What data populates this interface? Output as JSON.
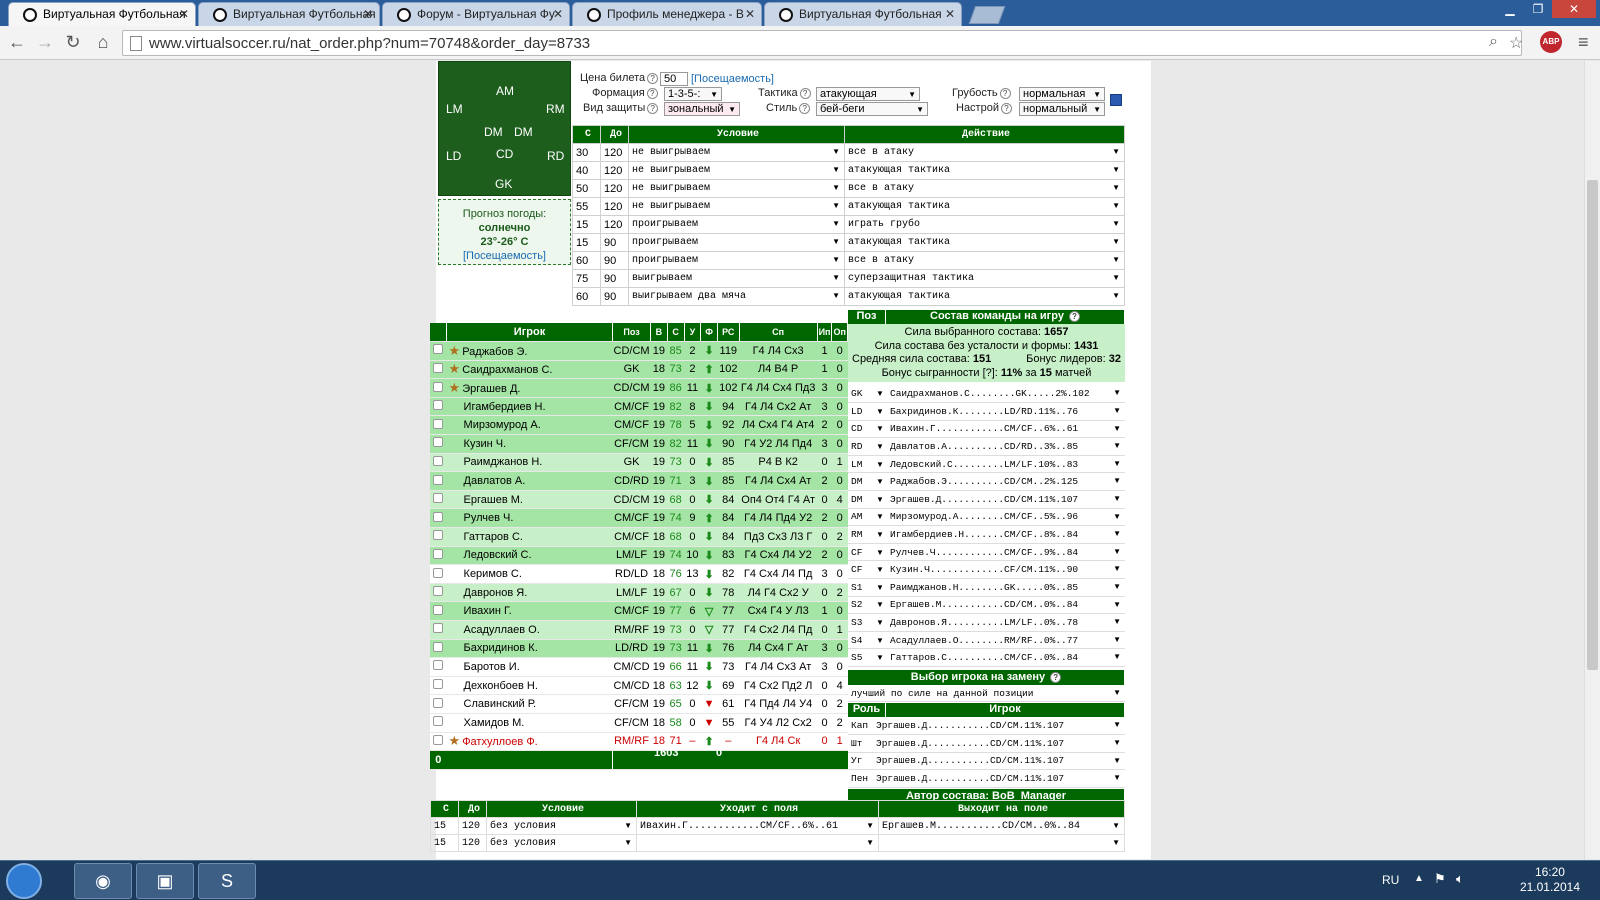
{
  "browser": {
    "tabs": [
      {
        "title": "Виртуальная Футбольная",
        "active": true
      },
      {
        "title": "Виртуальная Футбольная",
        "active": false
      },
      {
        "title": "Форум - Виртуальная Фу",
        "active": false
      },
      {
        "title": "Профиль менеджера - В",
        "active": false
      },
      {
        "title": "Виртуальная Футбольная",
        "active": false
      }
    ],
    "url": "www.virtualsoccer.ru/nat_order.php?num=70748&order_day=8733",
    "abp": "ABP"
  },
  "field": {
    "positions": [
      "AM",
      "LM",
      "RM",
      "DM",
      "DM",
      "LD",
      "CD",
      "RD",
      "GK"
    ]
  },
  "weather": {
    "label": "Прогноз погоды:",
    "condition": "солнечно",
    "temp": "23°-26° C",
    "link": "[Посещаемость]"
  },
  "settings": {
    "ticket_label": "Цена билета",
    "ticket_value": "50",
    "attendance_link": "[Посещаемость]",
    "formation_label": "Формация",
    "formation_value": "1-3-5-:",
    "defense_label": "Вид защиты",
    "defense_value": "зональный",
    "tactics_label": "Тактика",
    "tactics_value": "атакующая",
    "style_label": "Стиль",
    "style_value": "бей-беги",
    "rough_label": "Грубость",
    "rough_value": "нормальная",
    "mood_label": "Настрой",
    "mood_value": "нормальный"
  },
  "conditions": {
    "headers": [
      "С",
      "До",
      "Условие",
      "Действие"
    ],
    "rows": [
      [
        "30",
        "120",
        "не выигрываем",
        "все в атаку"
      ],
      [
        "40",
        "120",
        "не выигрываем",
        "атакующая тактика"
      ],
      [
        "50",
        "120",
        "не выигрываем",
        "все в атаку"
      ],
      [
        "55",
        "120",
        "не выигрываем",
        "атакующая тактика"
      ],
      [
        "15",
        "120",
        "проигрываем",
        "играть грубо"
      ],
      [
        "15",
        "90",
        "проигрываем",
        "атакующая тактика"
      ],
      [
        "60",
        "90",
        "проигрываем",
        "все в атаку"
      ],
      [
        "75",
        "90",
        "выигрываем",
        "суперзащитная тактика"
      ],
      [
        "60",
        "90",
        "выигрываем два мяча",
        "атакующая тактика"
      ]
    ]
  },
  "players": {
    "headers": [
      "",
      "Игрок",
      "Поз",
      "В",
      "С",
      "У",
      "Ф",
      "РС",
      "Сп",
      "Ип",
      "Оп"
    ],
    "rows": [
      {
        "star": true,
        "name": "Раджабов Э.",
        "pos": "CD/CM",
        "age": "19",
        "s": "85",
        "u": "2",
        "f": "down",
        "rs": "119",
        "sp": "Г4 Л4 Сх3",
        "ip": "1",
        "op": "0",
        "shade": "pr"
      },
      {
        "star": true,
        "name": "Саидрахманов С.",
        "pos": "GK",
        "age": "18",
        "s": "73",
        "u": "2",
        "f": "up",
        "rs": "102",
        "sp": "Л4 В4 Р",
        "ip": "1",
        "op": "0",
        "shade": "pr"
      },
      {
        "star": true,
        "name": "Эргашев Д.",
        "pos": "CD/CM",
        "age": "19",
        "s": "86",
        "u": "11",
        "f": "down",
        "rs": "102",
        "sp": "Г4 Л4 Сх4 Пд3",
        "ip": "3",
        "op": "0",
        "shade": "pr"
      },
      {
        "star": false,
        "name": "Игамбердиев Н.",
        "pos": "CM/CF",
        "age": "19",
        "s": "82",
        "u": "8",
        "f": "down",
        "rs": "94",
        "sp": "Г4 Л4 Сх2 Ат",
        "ip": "3",
        "op": "0",
        "shade": "pr"
      },
      {
        "star": false,
        "name": "Мирзомурод А.",
        "pos": "CM/CF",
        "age": "19",
        "s": "78",
        "u": "5",
        "f": "down",
        "rs": "92",
        "sp": "Л4 Сх4 Г4 Ат4",
        "ip": "2",
        "op": "0",
        "shade": "pr"
      },
      {
        "star": false,
        "name": "Кузин Ч.",
        "pos": "CF/CM",
        "age": "19",
        "s": "82",
        "u": "11",
        "f": "down",
        "rs": "90",
        "sp": "Г4 У2 Л4 Пд4",
        "ip": "3",
        "op": "0",
        "shade": "pr"
      },
      {
        "star": false,
        "name": "Раимджанов Н.",
        "pos": "GK",
        "age": "19",
        "s": "73",
        "u": "0",
        "f": "down",
        "rs": "85",
        "sp": "Р4 В К2",
        "ip": "0",
        "op": "1",
        "shade": "pr alt"
      },
      {
        "star": false,
        "name": "Давлатов А.",
        "pos": "CD/RD",
        "age": "19",
        "s": "71",
        "u": "3",
        "f": "down",
        "rs": "85",
        "sp": "Г4 Л4 Сх4 Ат",
        "ip": "2",
        "op": "0",
        "shade": "pr"
      },
      {
        "star": false,
        "name": "Ергашев М.",
        "pos": "CD/CM",
        "age": "19",
        "s": "68",
        "u": "0",
        "f": "down",
        "rs": "84",
        "sp": "Оп4 От4 Г4 Ат",
        "ip": "0",
        "op": "4",
        "shade": "pr alt"
      },
      {
        "star": false,
        "name": "Рулчев Ч.",
        "pos": "CM/CF",
        "age": "19",
        "s": "74",
        "u": "9",
        "f": "up",
        "rs": "84",
        "sp": "Г4 Л4 Пд4 У2",
        "ip": "2",
        "op": "0",
        "shade": "pr"
      },
      {
        "star": false,
        "name": "Гаттаров С.",
        "pos": "CM/CF",
        "age": "18",
        "s": "68",
        "u": "0",
        "f": "down",
        "rs": "84",
        "sp": "Пд3 Сх3 Л3 Г",
        "ip": "0",
        "op": "2",
        "shade": "pr alt"
      },
      {
        "star": false,
        "name": "Ледовский С.",
        "pos": "LM/LF",
        "age": "19",
        "s": "74",
        "u": "10",
        "f": "down",
        "rs": "83",
        "sp": "Г4 Сх4 Л4 У2",
        "ip": "2",
        "op": "0",
        "shade": "pr"
      },
      {
        "star": false,
        "name": "Керимов С.",
        "pos": "RD/LD",
        "age": "18",
        "s": "76",
        "u": "13",
        "f": "down",
        "rs": "82",
        "sp": "Г4 Сх4 Л4 Пд",
        "ip": "3",
        "op": "0",
        "shade": "pr hi"
      },
      {
        "star": false,
        "name": "Давронов Я.",
        "pos": "LM/LF",
        "age": "19",
        "s": "67",
        "u": "0",
        "f": "down",
        "rs": "78",
        "sp": "Л4 Г4 Сх2 У",
        "ip": "0",
        "op": "2",
        "shade": "pr alt"
      },
      {
        "star": false,
        "name": "Ивахин Г.",
        "pos": "CM/CF",
        "age": "19",
        "s": "77",
        "u": "6",
        "f": "flat",
        "rs": "77",
        "sp": "Сх4 Г4 У Л3",
        "ip": "1",
        "op": "0",
        "shade": "pr"
      },
      {
        "star": false,
        "name": "Асадуллаев О.",
        "pos": "RM/RF",
        "age": "19",
        "s": "73",
        "u": "0",
        "f": "flat",
        "rs": "77",
        "sp": "Г4 Сх2 Л4 Пд",
        "ip": "0",
        "op": "1",
        "shade": "pr alt"
      },
      {
        "star": false,
        "name": "Бахридинов К.",
        "pos": "LD/RD",
        "age": "19",
        "s": "73",
        "u": "11",
        "f": "down",
        "rs": "76",
        "sp": "Л4 Сх4 Г Ат",
        "ip": "3",
        "op": "0",
        "shade": "pr"
      },
      {
        "star": false,
        "name": "Баротов И.",
        "pos": "CM/CD",
        "age": "19",
        "s": "66",
        "u": "11",
        "f": "down",
        "rs": "73",
        "sp": "Г4 Л4 Сх3 Ат",
        "ip": "3",
        "op": "0",
        "shade": "pr hi"
      },
      {
        "star": false,
        "name": "Дехконбоев Н.",
        "pos": "CM/CD",
        "age": "18",
        "s": "63",
        "u": "12",
        "f": "down",
        "rs": "69",
        "sp": "Г4 Сх2 Пд2 Л",
        "ip": "0",
        "op": "4",
        "shade": "pr hi"
      },
      {
        "star": false,
        "name": "Славинский Р.",
        "pos": "CF/CM",
        "age": "19",
        "s": "65",
        "u": "0",
        "f": "reddown",
        "rs": "61",
        "sp": "Г4 Пд4 Л4 У4",
        "ip": "0",
        "op": "2",
        "shade": "pr hi"
      },
      {
        "star": false,
        "name": "Хамидов М.",
        "pos": "CF/CM",
        "age": "18",
        "s": "58",
        "u": "0",
        "f": "reddown",
        "rs": "55",
        "sp": "Г4 У4 Л2 Сх2",
        "ip": "0",
        "op": "2",
        "shade": "pr hi"
      },
      {
        "star": true,
        "name": "Фатхуллоев Ф.",
        "pos": "RM/RF",
        "age": "18",
        "s": "71",
        "u": "–",
        "f": "up",
        "rs": "–",
        "sp": "Г4 Л4 Ск",
        "ip": "0",
        "op": "1",
        "shade": "pr hi",
        "red": true
      }
    ],
    "footer": [
      "0",
      "1603",
      "0"
    ]
  },
  "lineup": {
    "header_pos": "Поз",
    "header_title": "Состав команды на игру",
    "strength_label": "Сила выбранного состава:",
    "strength": "1657",
    "fresh_label": "Сила состава без усталости и формы:",
    "fresh": "1431",
    "avg_label": "Средняя сила состава:",
    "avg": "151",
    "leaders_label": "Бонус лидеров:",
    "leaders": "32",
    "bonus_label": "Бонус сыгранности [?]:",
    "bonus": "11%",
    "bonus_mid": "за",
    "bonus_matches": "15",
    "bonus_tail": "матчей",
    "rows": [
      [
        "GK",
        "Саидрахманов.С........GK.....2%.102"
      ],
      [
        "LD",
        "Бахридинов.К........LD/RD.11%..76"
      ],
      [
        "CD",
        "Ивахин.Г............CM/CF..6%..61"
      ],
      [
        "RD",
        "Давлатов.А..........CD/RD..3%..85"
      ],
      [
        "LM",
        "Ледовский.С.........LM/LF.10%..83"
      ],
      [
        "DM",
        "Раджабов.Э..........CD/CM..2%.125"
      ],
      [
        "DM",
        "Эргашев.Д...........CD/CM.11%.107"
      ],
      [
        "AM",
        "Мирзомурод.А........CM/CF..5%..96"
      ],
      [
        "RM",
        "Игамбердиев.Н.......CM/CF..8%..84"
      ],
      [
        "CF",
        "Рулчев.Ч............CM/CF..9%..84"
      ],
      [
        "CF",
        "Кузин.Ч.............CF/CM.11%..90"
      ],
      [
        "S1",
        "Раимджанов.Н........GK.....0%..85"
      ],
      [
        "S2",
        "Ергашев.М...........CD/CM..0%..84"
      ],
      [
        "S3",
        "Давронов.Я..........LM/LF..0%..78"
      ],
      [
        "S4",
        "Асадуллаев.О........RM/RF..0%..77"
      ],
      [
        "S5",
        "Гаттаров.С..........CM/CF..0%..84"
      ]
    ],
    "replace_title": "Выбор игрока на замену",
    "replace_value": "лучший по силе на данной позиции",
    "role_header": "Роль",
    "player_header": "Игрок",
    "roles": [
      [
        "Кап",
        "Эргашев.Д...........CD/CM.11%.107"
      ],
      [
        "Шт",
        "Эргашев.Д...........CD/CM.11%.107"
      ],
      [
        "Уг",
        "Эргашев.Д...........CD/CM.11%.107"
      ],
      [
        "Пен",
        "Эргашев.Д...........CD/CM.11%.107"
      ]
    ],
    "author_label": "Автор состава:",
    "author": "BoB_Manager"
  },
  "subs": {
    "headers": [
      "С",
      "До",
      "Условие",
      "Уходит с поля",
      "Выходит на поле"
    ],
    "rows": [
      [
        "15",
        "120",
        "без условия",
        "Ивахин.Г............CM/CF..6%..61",
        "Ергашев.М...........CD/CM..0%..84"
      ],
      [
        "15",
        "120",
        "без условия",
        "",
        ""
      ]
    ]
  },
  "taskbar": {
    "lang": "RU",
    "time": "16:20",
    "date": "21.01.2014"
  }
}
